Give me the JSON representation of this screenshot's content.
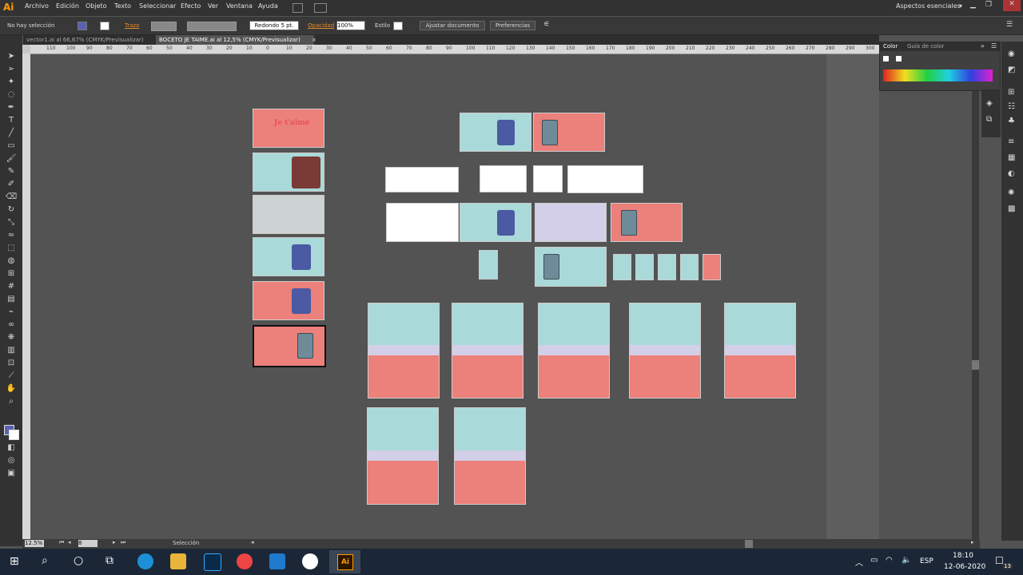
{
  "menu": {
    "app_logo": "Ai",
    "items": [
      "Archivo",
      "Edición",
      "Objeto",
      "Texto",
      "Seleccionar",
      "Efecto",
      "Ver",
      "Ventana",
      "Ayuda"
    ],
    "workspace": "Aspectos esenciales"
  },
  "control": {
    "selection": "No hay selección",
    "stroke_label": "Trazo",
    "brush": "Redondo 5 pt.",
    "opacity_label": "Opacidad",
    "opacity_value": "100%",
    "style_label": "Estilo",
    "fit_doc": "Ajustar documento",
    "prefs": "Preferencias"
  },
  "tabs": [
    {
      "label": "vector1.ai al 66,67% (CMYK/Previsualizar)"
    },
    {
      "label": "BOCETO JE TAIME.ai al 12,5% (CMYK/Previsualizar)"
    }
  ],
  "ruler": {
    "h_ticks": [
      "110",
      "100",
      "90",
      "80",
      "70",
      "60",
      "50",
      "40",
      "30",
      "20",
      "10",
      "0",
      "10",
      "20",
      "30",
      "40",
      "50",
      "60",
      "70",
      "80",
      "90",
      "100",
      "110",
      "120",
      "130",
      "140",
      "150",
      "160",
      "170",
      "180",
      "190",
      "200",
      "210",
      "220",
      "230",
      "240",
      "250",
      "260",
      "270",
      "280",
      "290",
      "300"
    ]
  },
  "panel": {
    "tab_color": "Color",
    "tab_guide": "Guía de color"
  },
  "status": {
    "zoom": "12.5%",
    "artboard": "8",
    "tool": "Selección"
  },
  "taskbar": {
    "lang": "ESP",
    "time": "18:10",
    "date": "12-06-2020",
    "notif": "13"
  },
  "artwork_text": {
    "logo": "Je t'aime"
  },
  "colors": {
    "coral": "#ec807a",
    "mint": "#a9d9d8",
    "accent": "#4b5aa3"
  }
}
